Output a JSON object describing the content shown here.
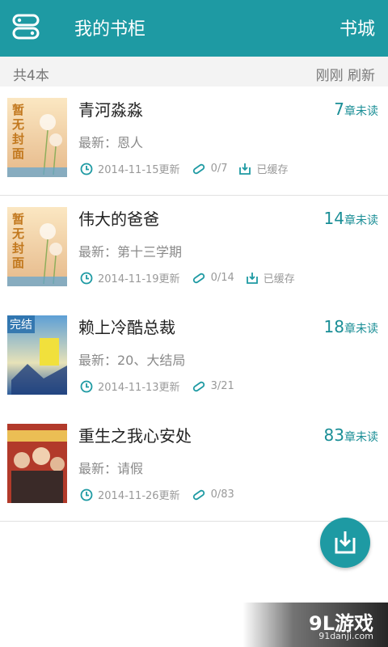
{
  "appbar": {
    "title": "我的书柜",
    "right_label": "书城"
  },
  "subbar": {
    "count": "共4本",
    "refresh": "刚刚 刷新"
  },
  "books": [
    {
      "title": "青河淼淼",
      "latest": "最新：恩人",
      "updated": "2014-11-15更新",
      "progress": "0/7",
      "cached": "已缓存",
      "unread_count": "7",
      "unread_suffix": "章未读",
      "cover": "暂无封面"
    },
    {
      "title": "伟大的爸爸",
      "latest": "最新：第十三学期",
      "updated": "2014-11-19更新",
      "progress": "0/14",
      "cached": "已缓存",
      "unread_count": "14",
      "unread_suffix": "章未读",
      "cover": "暂无封面"
    },
    {
      "title": "赖上冷酷总裁",
      "latest": "最新：20、大结局",
      "updated": "2014-11-13更新",
      "progress": "3/21",
      "unread_count": "18",
      "unread_suffix": "章未读",
      "cover_badge": "完结"
    },
    {
      "title": "重生之我心安处",
      "latest": "最新：请假",
      "updated": "2014-11-26更新",
      "progress": "0/83",
      "unread_count": "83",
      "unread_suffix": "章未读"
    }
  ],
  "watermark": {
    "logo": "9L游戏",
    "site": "91danji.com"
  },
  "colors": {
    "accent": "#1e9aa3",
    "unread_text": "#1a8e96"
  },
  "icons": [
    "menu-icon",
    "clock-icon",
    "paperclip-icon",
    "download-icon"
  ]
}
